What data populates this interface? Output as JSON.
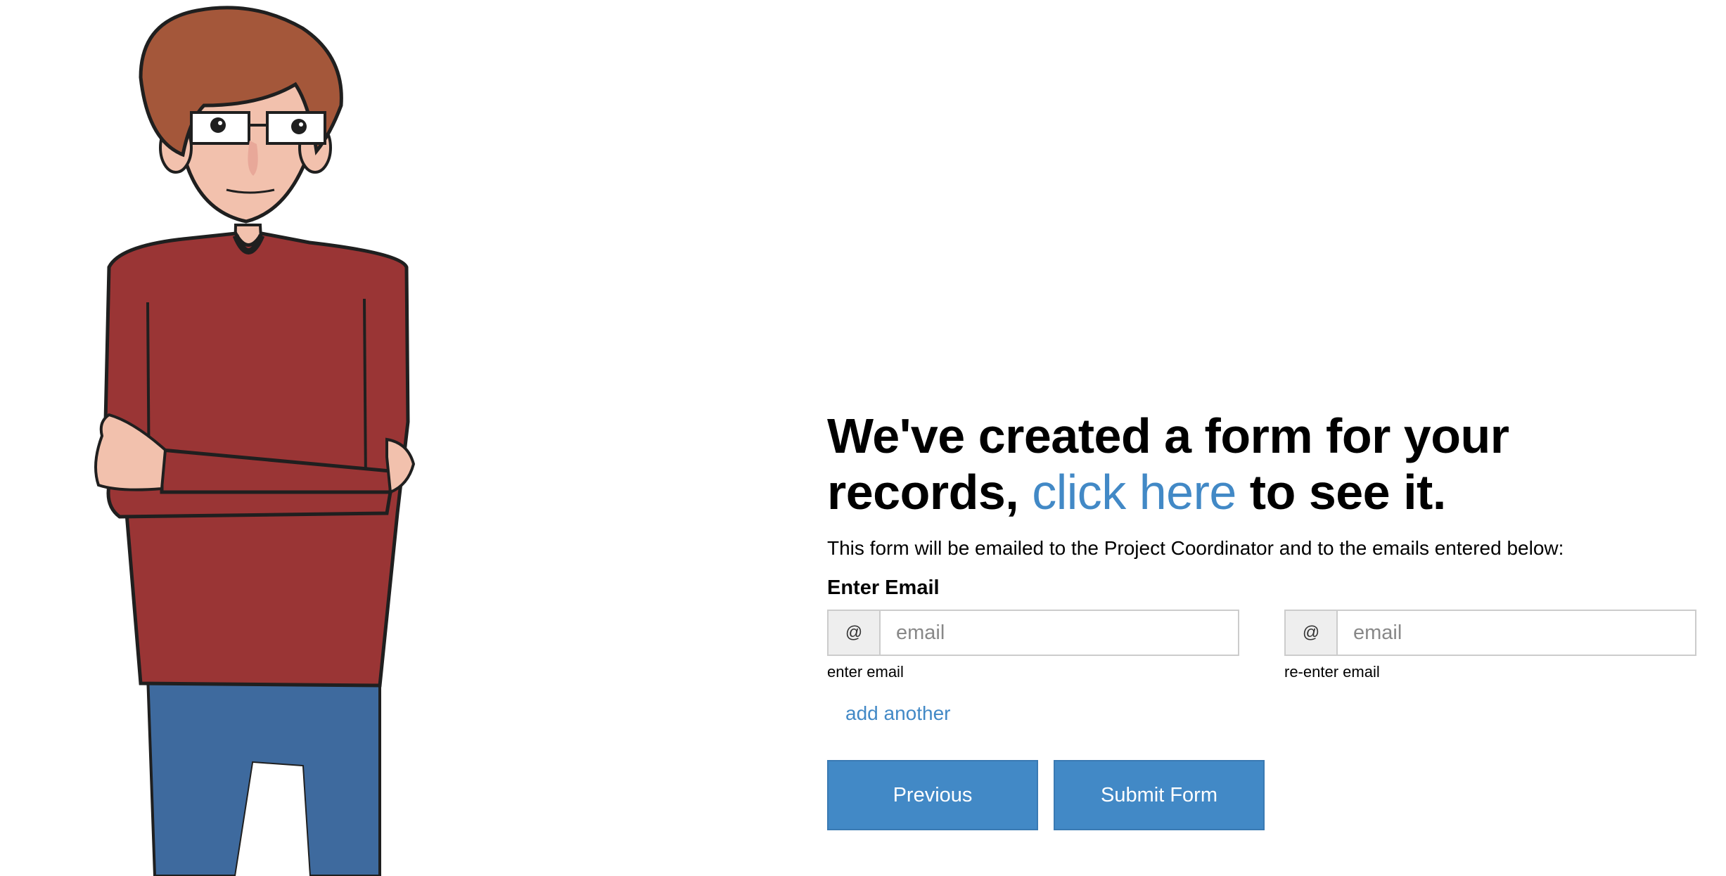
{
  "headline": {
    "part1": "We've created a form for your records, ",
    "link": "click here",
    "part2": " to see it."
  },
  "description": "This form will be emailed to the Project Coordinator and to the emails entered below:",
  "email_section": {
    "label": "Enter Email",
    "fields": [
      {
        "addon": "@",
        "placeholder": "email",
        "help": "enter email"
      },
      {
        "addon": "@",
        "placeholder": "email",
        "help": "re-enter email"
      }
    ],
    "add_another": "add another"
  },
  "buttons": {
    "previous": "Previous",
    "submit": "Submit Form"
  },
  "colors": {
    "accent": "#4289c6",
    "sweater": "#9a3535",
    "hair": "#a4573a",
    "jeans": "#3e6a9e",
    "skin": "#f2c1ad"
  },
  "icons": {
    "character": "cartoon-person-illustration"
  }
}
